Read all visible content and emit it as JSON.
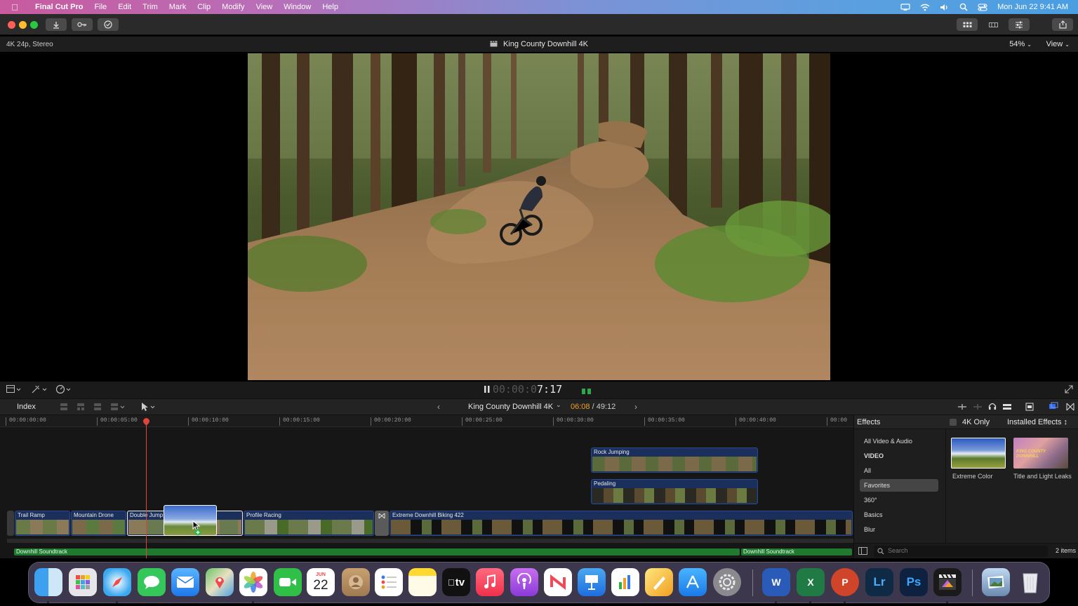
{
  "menubar": {
    "apple_icon": "apple-icon",
    "items": [
      "Final Cut Pro",
      "File",
      "Edit",
      "Trim",
      "Mark",
      "Clip",
      "Modify",
      "View",
      "Window",
      "Help"
    ],
    "datetime": "Mon Jun 22  9:41 AM"
  },
  "viewer": {
    "format": "4K 24p, Stereo",
    "title": "King County Downhill 4K",
    "zoom": "54%",
    "view_menu": "View"
  },
  "playback": {
    "timecode_dim": "00:00:0",
    "timecode_bright": "7:17"
  },
  "timeline_header": {
    "index": "Index",
    "project": "King County Downhill 4K",
    "position_current": "06:08",
    "position_total": " / 49:12"
  },
  "ruler": [
    "00:00:00:00",
    "00:00:05:00",
    "00:00:10:00",
    "00:00:15:00",
    "00:00:20:00",
    "00:00:25:00",
    "00:00:30:00",
    "00:00:35:00",
    "00:00:40:00",
    "00:00"
  ],
  "clips": {
    "connected": [
      "Rock Jumping",
      "Pedaling"
    ],
    "primary": [
      "Trail Ramp",
      "Mountain Drone",
      "Double Jump",
      "Profile Racing",
      "Extreme Downhill Biking 422"
    ],
    "audio": [
      "Downhill Soundtrack",
      "Downhill Soundtrack"
    ]
  },
  "effects": {
    "title": "Effects",
    "filter_label": "4K Only",
    "installed": "Installed Effects",
    "categories": [
      "All Video & Audio",
      "VIDEO",
      "All",
      "Favorites",
      "360°",
      "Basics",
      "Blur"
    ],
    "selected_category": "Favorites",
    "items": [
      "Extreme Color",
      "Title and Light Leaks"
    ],
    "thumb_text": "KING COUNTY DOWNHILL",
    "search_placeholder": "Search",
    "count": "2 items"
  },
  "dock": {
    "apps": [
      "Finder",
      "Launchpad",
      "Safari",
      "Messages",
      "Mail",
      "Maps",
      "Photos",
      "FaceTime",
      "Calendar",
      "Contacts",
      "Reminders",
      "Notes",
      "TV",
      "Music",
      "Podcasts",
      "News",
      "Keynote",
      "Numbers",
      "Pages",
      "App Store",
      "System Preferences",
      "Word",
      "Excel",
      "PowerPoint",
      "Lightroom",
      "Photoshop",
      "Final Cut Pro",
      "Preview",
      "Trash"
    ],
    "calendar_month": "JUN",
    "calendar_day": "22",
    "tv_label": "tv",
    "word_letter": "W",
    "excel_letter": "X",
    "ppt_letter": "P",
    "lr_letter": "Lr",
    "ps_letter": "Ps"
  }
}
